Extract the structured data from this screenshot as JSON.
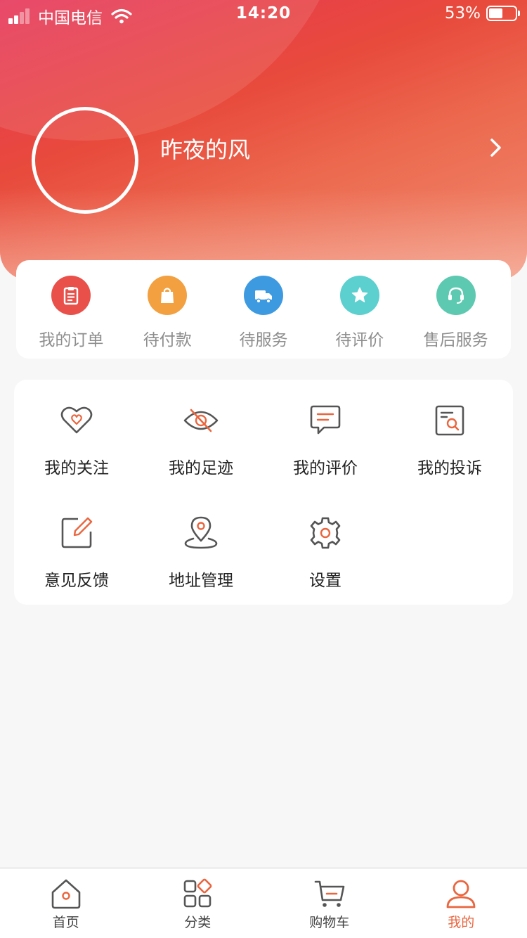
{
  "status_bar": {
    "carrier": "中国电信",
    "time": "14:20",
    "battery_percent": "53%",
    "battery_level": 0.53
  },
  "profile": {
    "username": "昨夜的风"
  },
  "orders": [
    {
      "label": "我的订单",
      "icon": "order-list-icon",
      "color": "#e9504a"
    },
    {
      "label": "待付款",
      "icon": "shopping-bag-icon",
      "color": "#f2a040"
    },
    {
      "label": "待服务",
      "icon": "delivery-truck-icon",
      "color": "#3e9ae0"
    },
    {
      "label": "待评价",
      "icon": "star-icon",
      "color": "#5ccfcf"
    },
    {
      "label": "售后服务",
      "icon": "headset-icon",
      "color": "#5cc9b0"
    }
  ],
  "tools": [
    {
      "label": "我的关注",
      "icon": "heart-icon"
    },
    {
      "label": "我的足迹",
      "icon": "eye-off-icon"
    },
    {
      "label": "我的评价",
      "icon": "comment-icon"
    },
    {
      "label": "我的投诉",
      "icon": "complaint-search-icon"
    },
    {
      "label": "意见反馈",
      "icon": "edit-feedback-icon"
    },
    {
      "label": "地址管理",
      "icon": "location-pin-icon"
    },
    {
      "label": "设置",
      "icon": "gear-icon"
    }
  ],
  "tabs": [
    {
      "label": "首页",
      "icon": "home-icon",
      "active": false
    },
    {
      "label": "分类",
      "icon": "category-icon",
      "active": false
    },
    {
      "label": "购物车",
      "icon": "cart-icon",
      "active": false
    },
    {
      "label": "我的",
      "icon": "user-icon",
      "active": true
    }
  ],
  "colors": {
    "accent": "#e9663f",
    "icon_gray": "#555555",
    "header_start": "#e63559",
    "header_end": "#f08a70"
  }
}
